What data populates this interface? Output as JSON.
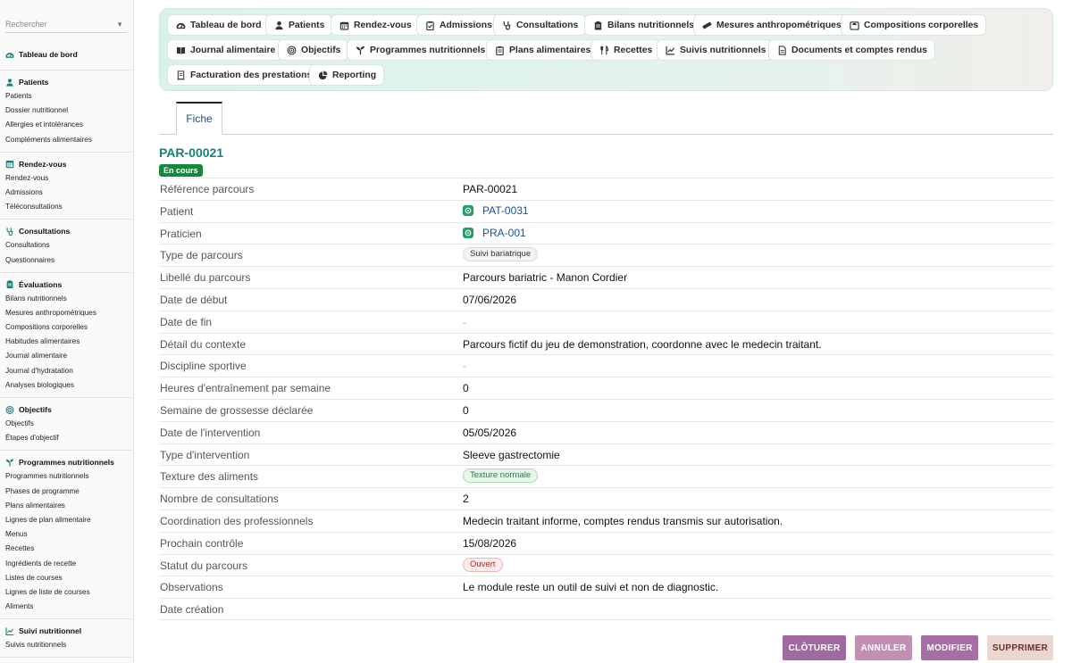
{
  "sidebar": {
    "search_placeholder": "Rechercher",
    "sections": [
      {
        "title": "Tableau de bord",
        "icon": "gauge-icon",
        "items": []
      },
      {
        "title": "Patients",
        "icon": "person-icon",
        "items": [
          "Patients",
          "Dossier nutritionnel",
          "Allergies et intolérances",
          "Compléments alimentaires"
        ]
      },
      {
        "title": "Rendez-vous",
        "icon": "calendar-icon",
        "items": [
          "Rendez-vous",
          "Admissions",
          "Téléconsultations"
        ]
      },
      {
        "title": "Consultations",
        "icon": "stethoscope-icon",
        "items": [
          "Consultations",
          "Questionnaires"
        ]
      },
      {
        "title": "Évaluations",
        "icon": "clipboard-icon",
        "items": [
          "Bilans nutritionnels",
          "Mesures anthropométriques",
          "Compositions corporelles",
          "Habitudes alimentaires",
          "Journal alimentaire",
          "Journal d'hydratation",
          "Analyses biologiques"
        ]
      },
      {
        "title": "Objectifs",
        "icon": "target-icon",
        "items": [
          "Objectifs",
          "Étapes d'objectif"
        ]
      },
      {
        "title": "Programmes nutritionnels",
        "icon": "sprout-icon",
        "items": [
          "Programmes nutritionnels",
          "Phases de programme",
          "Plans alimentaires",
          "Lignes de plan alimentaire",
          "Menus",
          "Recettes",
          "Ingrédients de recette",
          "Listes de courses",
          "Lignes de liste de courses",
          "Aliments"
        ]
      },
      {
        "title": "Suivi nutritionnel",
        "icon": "chart-line-icon",
        "items": [
          "Suivis nutritionnels"
        ]
      }
    ]
  },
  "topmenu": [
    {
      "label": "Tableau de bord",
      "icon": "gauge-icon"
    },
    {
      "label": "Patients",
      "icon": "person-icon"
    },
    {
      "label": "Rendez-vous",
      "icon": "calendar-icon"
    },
    {
      "label": "Admissions",
      "icon": "clipboard-check-icon"
    },
    {
      "label": "Consultations",
      "icon": "stethoscope-icon"
    },
    {
      "label": "Bilans nutritionnels",
      "icon": "clipboard-icon"
    },
    {
      "label": "Mesures anthropométriques",
      "icon": "ruler-icon"
    },
    {
      "label": "Compositions corporelles",
      "icon": "scale-icon"
    },
    {
      "label": "Journal alimentaire",
      "icon": "book-icon"
    },
    {
      "label": "Objectifs",
      "icon": "target-icon"
    },
    {
      "label": "Programmes nutritionnels",
      "icon": "sprout-icon"
    },
    {
      "label": "Plans alimentaires",
      "icon": "clipboard-list-icon"
    },
    {
      "label": "Recettes",
      "icon": "utensils-icon"
    },
    {
      "label": "Suivis nutritionnels",
      "icon": "chart-line-icon"
    },
    {
      "label": "Documents et comptes rendus",
      "icon": "document-icon"
    },
    {
      "label": "Facturation des prestations",
      "icon": "invoice-icon"
    },
    {
      "label": "Reporting",
      "icon": "pie-chart-icon"
    }
  ],
  "tabs": {
    "fiche": "Fiche"
  },
  "record": {
    "id": "PAR-00021",
    "status": "En cours",
    "fields": [
      {
        "label": "Référence parcours",
        "type": "text",
        "value": "PAR-00021"
      },
      {
        "label": "Patient",
        "type": "link",
        "value": "PAT-0031"
      },
      {
        "label": "Praticien",
        "type": "link",
        "value": "PRA-001"
      },
      {
        "label": "Type de parcours",
        "type": "badge",
        "style": "grey",
        "value": "Suivi bariatrique"
      },
      {
        "label": "Libellé du parcours",
        "type": "text",
        "value": "Parcours bariatric - Manon Cordier"
      },
      {
        "label": "Date de début",
        "type": "text",
        "value": "07/06/2026"
      },
      {
        "label": "Date de fin",
        "type": "dash",
        "value": "-"
      },
      {
        "label": "Détail du contexte",
        "type": "text",
        "value": "Parcours fictif du jeu de demonstration, coordonne avec le medecin traitant."
      },
      {
        "label": "Discipline sportive",
        "type": "dash",
        "value": "-"
      },
      {
        "label": "Heures d'entraînement par semaine",
        "type": "text",
        "value": "0"
      },
      {
        "label": "Semaine de grossesse déclarée",
        "type": "text",
        "value": "0"
      },
      {
        "label": "Date de l'intervention",
        "type": "text",
        "value": "05/05/2026"
      },
      {
        "label": "Type d'intervention",
        "type": "text",
        "value": "Sleeve gastrectomie"
      },
      {
        "label": "Texture des aliments",
        "type": "badge",
        "style": "green",
        "value": "Texture normale"
      },
      {
        "label": "Nombre de consultations",
        "type": "text",
        "value": "2"
      },
      {
        "label": "Coordination des professionnels",
        "type": "text",
        "value": "Medecin traitant informe, comptes rendus transmis sur autorisation."
      },
      {
        "label": "Prochain contrôle",
        "type": "text",
        "value": "15/08/2026"
      },
      {
        "label": "Statut du parcours",
        "type": "badge",
        "style": "red",
        "value": "Ouvert"
      },
      {
        "label": "Observations",
        "type": "text",
        "value": "Le module reste un outil de suivi et non de diagnostic."
      },
      {
        "label": "Date création",
        "type": "text",
        "value": ""
      }
    ]
  },
  "actions": {
    "close_label": "CLÔTURER",
    "cancel_label": "ANNULER",
    "edit_label": "MODIFIER",
    "delete_label": "SUPPRIMER"
  },
  "colors": {
    "accent_teal": "#16807a",
    "status_green": "#17873e",
    "close_btn": "#a06aa0",
    "cancel_btn": "#c28fb3",
    "edit_btn": "#a76ea6",
    "delete_btn": "#ead8d0"
  }
}
